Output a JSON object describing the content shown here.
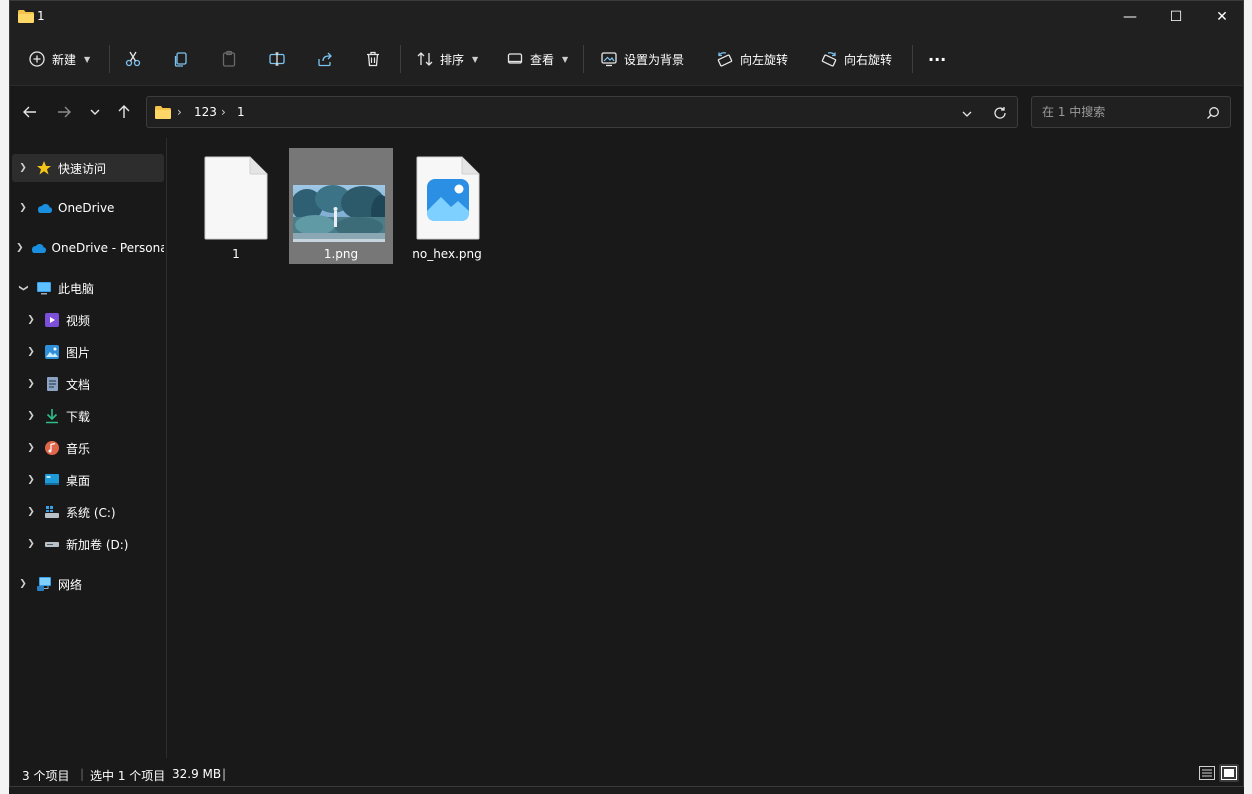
{
  "window": {
    "title": "1"
  },
  "window_controls": {
    "minimize": "—",
    "maximize": "☐",
    "close": "✕"
  },
  "toolbar": {
    "new_label": "新建",
    "sort_label": "排序",
    "view_label": "查看",
    "set_background_label": "设置为背景",
    "rotate_left_label": "向左旋转",
    "rotate_right_label": "向右旋转",
    "more_label": "···"
  },
  "address": {
    "crumbs": [
      "123",
      "1"
    ]
  },
  "search": {
    "placeholder": "在 1 中搜索"
  },
  "sidebar": {
    "items": [
      {
        "label": "快速访问",
        "icon": "star-icon"
      },
      {
        "label": "OneDrive",
        "icon": "cloud-icon"
      },
      {
        "label": "OneDrive - Persona",
        "icon": "cloud-icon"
      },
      {
        "label": "此电脑",
        "icon": "computer-icon"
      },
      {
        "label": "视频",
        "icon": "video-icon"
      },
      {
        "label": "图片",
        "icon": "pictures-icon"
      },
      {
        "label": "文档",
        "icon": "documents-icon"
      },
      {
        "label": "下载",
        "icon": "download-icon"
      },
      {
        "label": "音乐",
        "icon": "music-icon"
      },
      {
        "label": "桌面",
        "icon": "desktop-icon"
      },
      {
        "label": "系统 (C:)",
        "icon": "system-drive-icon"
      },
      {
        "label": "新加卷 (D:)",
        "icon": "drive-icon"
      },
      {
        "label": "网络",
        "icon": "network-icon"
      }
    ]
  },
  "files": [
    {
      "name": "1",
      "icon": "blank-file-icon",
      "selected": false
    },
    {
      "name": "1.png",
      "icon": "image-thumbnail",
      "selected": true
    },
    {
      "name": "no_hex.png",
      "icon": "photo-file-icon",
      "selected": false
    }
  ],
  "status": {
    "count": "3 个项目",
    "selection": "选中 1 个项目",
    "size": "32.9 MB"
  },
  "colors": {
    "accent": "#4cc2ff",
    "selection": "#777777",
    "folder": "#f4c34a"
  }
}
